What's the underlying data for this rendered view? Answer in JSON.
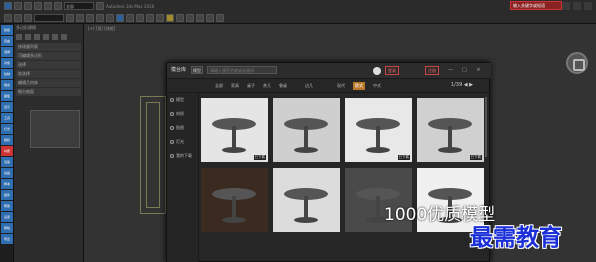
{
  "toolbar": {
    "row1_field1": "全部",
    "row1_field2": "",
    "row1_text": "Autodesk 3ds Max 2016",
    "red_field": "输入关键字或短语"
  },
  "side_panel": {
    "title": "多边形建模",
    "rows": [
      "修改器列表",
      "可编辑多边形",
      "选择",
      "软选择",
      "编辑几何体",
      "细分曲面"
    ]
  },
  "left_strip": {
    "buttons": [
      "建模",
      "自由",
      "选择",
      "对象",
      "绘制",
      "填充",
      "面板",
      "显示",
      "工具",
      "灯光",
      "相机",
      "材质",
      "渲染",
      "动画",
      "脚本",
      "插件",
      "帮助",
      "设置",
      "网格",
      "导出"
    ]
  },
  "viewport": {
    "label": "[+] [顶] [线框]"
  },
  "dialog": {
    "logo": "模台库",
    "dropdown": "模型",
    "search_placeholder": "请输入模型名称或关键词",
    "btn_login": "登录",
    "btn_register": "注册",
    "ctrl_min": "—",
    "ctrl_max": "□",
    "ctrl_close": "×",
    "chips": [
      "全部",
      "家具",
      "桌子",
      "茶几",
      "餐桌",
      "边几",
      "现代",
      "欧式",
      "中式"
    ],
    "pager": "1/39  ◀ ▶",
    "nav": [
      "模型",
      "材质",
      "贴图",
      "灯光",
      "我的下载"
    ],
    "tiles": [
      {
        "tag": "已下载"
      },
      {
        "tag": ""
      },
      {
        "tag": "已下载"
      },
      {
        "tag": "已下载"
      },
      {
        "tag": ""
      },
      {
        "tag": ""
      },
      {
        "tag": ""
      },
      {
        "tag": ""
      }
    ]
  },
  "overlay": {
    "watermark": "1000优质模型",
    "brand": "最需教育"
  }
}
